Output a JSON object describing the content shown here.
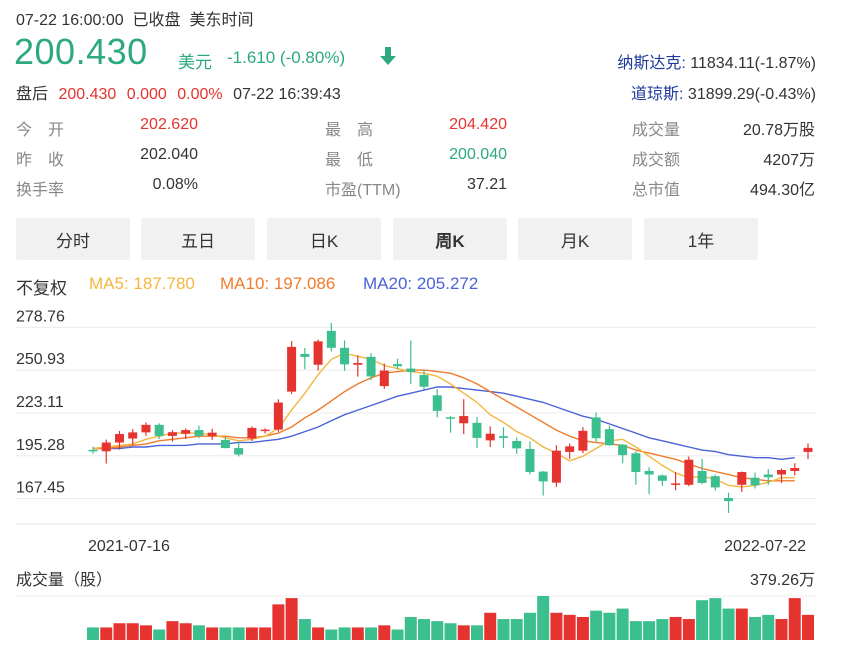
{
  "header": {
    "datetime": "07-22 16:00:00",
    "status": "已收盘",
    "tz": "美东时间",
    "price": "200.430",
    "unit": "美元",
    "change": "-1.610 (-0.80%)",
    "after_label": "盘后",
    "after_price": "200.430",
    "after_change": "0.000",
    "after_pct": "0.00%",
    "after_time": "07-22 16:39:43"
  },
  "indices": [
    {
      "name": "纳斯达克:",
      "value": " 11834.11(-1.87%)"
    },
    {
      "name": "道琼斯:",
      "value": " 31899.29(-0.43%)"
    }
  ],
  "stats": [
    {
      "label": "今　开",
      "value": "202.620",
      "color": "#e5332f"
    },
    {
      "label": "昨　收",
      "value": "202.040",
      "color": "#333333"
    },
    {
      "label": "换手率",
      "value": "0.08%",
      "color": "#333333"
    },
    {
      "label": "最　高",
      "value": "204.420",
      "color": "#e5332f"
    },
    {
      "label": "最　低",
      "value": "200.040",
      "color": "#2da880"
    },
    {
      "label": "市盈(TTM)",
      "value": "37.21",
      "color": "#333333"
    },
    {
      "label": "成交量",
      "value": "20.78万股",
      "color": "#333333"
    },
    {
      "label": "成交额",
      "value": "4207万",
      "color": "#333333"
    },
    {
      "label": "总市值",
      "value": "494.30亿",
      "color": "#333333"
    }
  ],
  "tabs": [
    "分时",
    "五日",
    "日K",
    "周K",
    "月K",
    "1年"
  ],
  "active_tab": "周K",
  "legend": {
    "adj": "不复权",
    "ma5": "MA5: 187.780",
    "ma10": "MA10: 197.086",
    "ma20": "MA20: 205.272"
  },
  "colors": {
    "up": "#e5332f",
    "down": "#3cbf8e",
    "ma5": "#f4b63f",
    "ma10": "#f07b2c",
    "ma20": "#4a62d8"
  },
  "chart_data": {
    "type": "candlestick",
    "y_ticks": [
      "278.76",
      "250.93",
      "223.11",
      "195.28",
      "167.45"
    ],
    "ylim": [
      153.5,
      292.7
    ],
    "x_start_label": "2021-07-16",
    "x_end_label": "2022-07-22",
    "candles": [
      [
        199.1,
        201.2,
        196.6,
        198.2
      ],
      [
        198.2,
        205.8,
        190.2,
        203.9
      ],
      [
        203.9,
        211.5,
        199.3,
        209.4
      ],
      [
        206.5,
        212.6,
        202.4,
        210.5
      ],
      [
        210.5,
        217.0,
        208.3,
        215.4
      ],
      [
        215.4,
        216.4,
        206.2,
        208.2
      ],
      [
        208.2,
        211.9,
        204.5,
        210.6
      ],
      [
        209.6,
        213.1,
        206.2,
        212.0
      ],
      [
        212.0,
        214.9,
        206.7,
        208.2
      ],
      [
        208.2,
        212.9,
        205.6,
        210.3
      ],
      [
        205.6,
        207.4,
        200.1,
        200.3
      ],
      [
        200.3,
        204.2,
        194.8,
        196.1
      ],
      [
        206.5,
        214.4,
        204.9,
        213.4
      ],
      [
        211.9,
        213.1,
        209.8,
        212.3
      ],
      [
        212.3,
        232.0,
        210.8,
        229.9
      ],
      [
        237.0,
        269.9,
        235.5,
        266.1
      ],
      [
        261.5,
        265.4,
        251.5,
        259.6
      ],
      [
        254.5,
        270.8,
        250.7,
        269.7
      ],
      [
        276.5,
        281.8,
        263.2,
        265.5
      ],
      [
        265.5,
        270.3,
        250.6,
        254.7
      ],
      [
        254.5,
        260.6,
        246.8,
        255.6
      ],
      [
        259.6,
        262.1,
        244.5,
        246.9
      ],
      [
        240.6,
        255.3,
        238.9,
        250.7
      ],
      [
        254.9,
        258.4,
        251.6,
        253.5
      ],
      [
        252.0,
        270.3,
        242.1,
        249.8
      ],
      [
        247.8,
        251.1,
        238.5,
        240.2
      ],
      [
        234.6,
        238.6,
        220.3,
        224.5
      ],
      [
        220.3,
        221.3,
        210.3,
        219.8
      ],
      [
        216.4,
        232.1,
        209.4,
        221.1
      ],
      [
        216.7,
        220.6,
        200.3,
        206.9
      ],
      [
        205.3,
        214.4,
        201.0,
        209.6
      ],
      [
        208.0,
        213.9,
        200.3,
        206.9
      ],
      [
        204.9,
        207.1,
        196.5,
        200.1
      ],
      [
        199.7,
        204.6,
        183.3,
        184.7
      ],
      [
        185.0,
        185.4,
        169.4,
        178.6
      ],
      [
        177.8,
        202.1,
        175.1,
        198.6
      ],
      [
        197.8,
        203.3,
        193.2,
        201.4
      ],
      [
        198.6,
        213.9,
        196.9,
        211.5
      ],
      [
        220.2,
        223.4,
        204.4,
        206.7
      ],
      [
        212.6,
        214.9,
        201.8,
        202.1
      ],
      [
        202.5,
        202.9,
        190.4,
        195.7
      ],
      [
        196.9,
        198.2,
        176.4,
        184.7
      ],
      [
        185.4,
        187.8,
        170.3,
        183.1
      ],
      [
        182.5,
        183.1,
        175.7,
        179.0
      ],
      [
        176.4,
        184.7,
        172.8,
        177.3
      ],
      [
        176.4,
        194.8,
        175.5,
        192.7
      ],
      [
        185.4,
        193.2,
        176.8,
        177.6
      ],
      [
        182.0,
        183.1,
        172.7,
        174.7
      ],
      [
        167.8,
        171.3,
        158.1,
        165.8
      ],
      [
        176.4,
        185.0,
        171.8,
        184.7
      ],
      [
        181.0,
        184.3,
        174.0,
        176.1
      ],
      [
        183.1,
        186.5,
        176.4,
        181.3
      ],
      [
        183.1,
        187.0,
        177.6,
        186.0
      ],
      [
        185.4,
        190.4,
        182.5,
        187.3
      ],
      [
        197.8,
        203.3,
        193.2,
        200.4
      ]
    ],
    "ma5": [
      200,
      201,
      202,
      203,
      206,
      208,
      210,
      210,
      210,
      209,
      207,
      205,
      206,
      208,
      213,
      225,
      236,
      248,
      258,
      262,
      260,
      258,
      254,
      252,
      250,
      249,
      247,
      242,
      236,
      230,
      222,
      217,
      211,
      207,
      201,
      197,
      192,
      195,
      200,
      205,
      206,
      201,
      195,
      189,
      184,
      181,
      182,
      180,
      176,
      175,
      176,
      178,
      181,
      181,
      187.78
    ],
    "ma10": [
      200,
      200,
      201,
      202,
      203,
      205,
      206,
      207,
      208,
      208,
      208,
      207,
      207,
      208,
      210,
      214,
      220,
      225,
      231,
      237,
      242,
      246,
      249,
      250,
      251,
      251,
      250,
      249,
      246,
      242,
      237,
      232,
      227,
      222,
      217,
      212,
      208,
      205,
      204,
      203,
      202,
      199,
      197,
      195,
      193,
      190,
      187,
      185,
      183,
      181,
      180,
      179,
      179,
      179,
      197.086
    ],
    "ma20": [
      200,
      200,
      200,
      201,
      201,
      202,
      202,
      202,
      203,
      203,
      203,
      204,
      204,
      205,
      206,
      208,
      211,
      214,
      218,
      222,
      225,
      228,
      231,
      234,
      236,
      238,
      240,
      240,
      239,
      238,
      237,
      236,
      234,
      232,
      230,
      227,
      224,
      221,
      219,
      216,
      213,
      210,
      207,
      205,
      203,
      201,
      199,
      198,
      196,
      195,
      194,
      194,
      193,
      194,
      205.272
    ],
    "volume_label": "成交量（股）",
    "volume_max_label": "379.26万",
    "volumes": [
      0.3,
      0.3,
      0.4,
      0.4,
      0.35,
      0.25,
      0.45,
      0.4,
      0.35,
      0.3,
      0.3,
      0.3,
      0.3,
      0.3,
      0.85,
      1.0,
      0.5,
      0.3,
      0.25,
      0.3,
      0.3,
      0.3,
      0.35,
      0.25,
      0.55,
      0.5,
      0.45,
      0.4,
      0.35,
      0.35,
      0.65,
      0.5,
      0.5,
      0.65,
      1.05,
      0.65,
      0.6,
      0.55,
      0.7,
      0.65,
      0.75,
      0.45,
      0.45,
      0.5,
      0.55,
      0.5,
      0.95,
      1.0,
      0.75,
      0.75,
      0.55,
      0.6,
      0.5,
      1.0,
      0.6
    ]
  }
}
